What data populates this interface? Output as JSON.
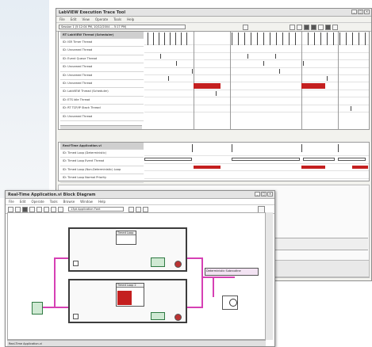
{
  "trace_window": {
    "title": "LabVIEW Execution Trace Tool",
    "menus": [
      "File",
      "Edit",
      "View",
      "Operate",
      "Tools",
      "Help"
    ],
    "session_field": "Session 1 (5:12:04 PM, 10/12/2004 ... 5:17 PM)",
    "threads_header": "RT LabVIEW Thread (Scheduler)",
    "threads": [
      "ID: ISR Timer Thread",
      "ID: Unnamed Thread",
      "ID: Event Queue Thread",
      "ID: Unnamed Thread",
      "ID: Unnamed Thread",
      "ID: Unnamed Thread",
      "ID: LabVIEW Thread (Scheduler)",
      "ID: ETS Idle Thread",
      "ID: RT TCP/IP Stack Thread",
      "ID: Unnamed Thread"
    ],
    "vis_header": "Real-Time Application.vi",
    "vis": [
      "ID: Timed Loop (Deterministic)",
      "ID: Timed Loop Event Thread",
      "ID: Timed Loop (Non-Deterministic) Loop",
      "ID: Timed Loop Normal Priority"
    ]
  },
  "diagram_window": {
    "title": "Real-Time Application.vi Block Diagram",
    "menus": [
      "File",
      "Edit",
      "Operate",
      "Tools",
      "Browse",
      "Window",
      "Help"
    ],
    "font_field": "13pt Application Font",
    "node_top_label": "Timed Loop",
    "node_red_label": "Timed Loop 2",
    "subvi_label": "Deterministic Subroutine",
    "status": "Real-Time Application.vi"
  },
  "colors": {
    "execution_red": "#c41f1f",
    "wire_pink": "#d640b4",
    "node_green": "#2f7a43"
  }
}
